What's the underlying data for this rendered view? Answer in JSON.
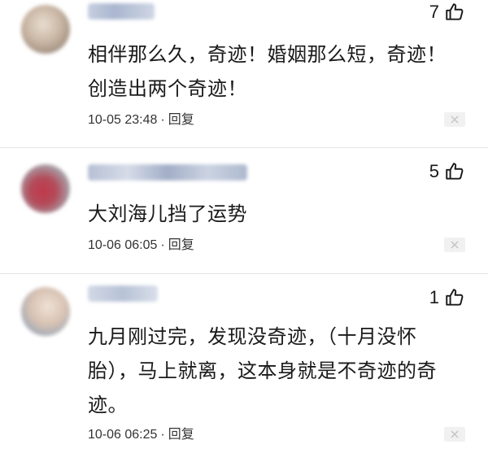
{
  "comments": [
    {
      "username": "",
      "likes": "7",
      "text": "相伴那么久，奇迹！婚姻那么短，奇迹！创造出两个奇迹！",
      "time": "10-05 23:48",
      "reply_label": "回复"
    },
    {
      "username": "",
      "likes": "5",
      "text": "大刘海儿挡了运势",
      "time": "10-06 06:05",
      "reply_label": "回复"
    },
    {
      "username": "",
      "likes": "1",
      "text": "九月刚过完，发现没奇迹，（十月没怀胎），马上就离，这本身就是不奇迹的奇迹。",
      "time": "10-06 06:25",
      "reply_label": "回复"
    }
  ],
  "separator": "·",
  "icons": {
    "like": "thumbs-up-icon",
    "dismiss": "close-icon"
  },
  "colors": {
    "text": "#1a1a1a",
    "meta": "#333333",
    "divider": "#e4e4e4",
    "dismiss_bg": "#f1f1f1"
  }
}
